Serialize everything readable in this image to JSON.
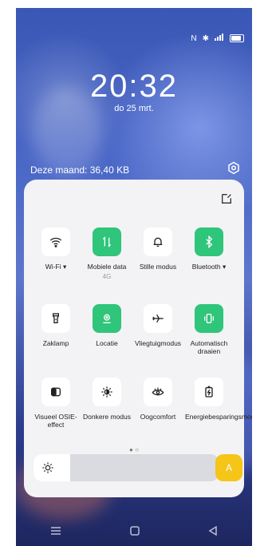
{
  "status": {
    "icons": [
      "nfc-icon",
      "bluetooth-icon",
      "signal-icon",
      "battery-icon"
    ]
  },
  "lock": {
    "time": "20:32",
    "date": "do 25 mrt."
  },
  "usage": {
    "text": "Deze maand: 36,40 KB"
  },
  "panel": {
    "tiles": [
      {
        "label": "Wi-Fi ▾",
        "sublabel": "",
        "icon": "wifi-icon",
        "active": false
      },
      {
        "label": "Mobiele data",
        "sublabel": "4G",
        "icon": "mobile-data-icon",
        "active": true
      },
      {
        "label": "Stille modus",
        "sublabel": "",
        "icon": "bell-icon",
        "active": false
      },
      {
        "label": "Bluetooth ▾",
        "sublabel": "",
        "icon": "bluetooth-icon",
        "active": true
      },
      {
        "label": "Zaklamp",
        "sublabel": "",
        "icon": "flashlight-icon",
        "active": false
      },
      {
        "label": "Locatie",
        "sublabel": "",
        "icon": "location-icon",
        "active": true
      },
      {
        "label": "Vliegtuigmodus",
        "sublabel": "",
        "icon": "airplane-icon",
        "active": false
      },
      {
        "label": "Automatisch draaien",
        "sublabel": "",
        "icon": "auto-rotate-icon",
        "active": true
      },
      {
        "label": "Visueel OSIE-effect",
        "sublabel": "",
        "icon": "osie-icon",
        "active": false
      },
      {
        "label": "Donkere modus",
        "sublabel": "",
        "icon": "dark-mode-icon",
        "active": false
      },
      {
        "label": "Oogcomfort",
        "sublabel": "",
        "icon": "eye-icon",
        "active": false
      },
      {
        "label": "Energiebesparingsmodus",
        "sublabel": "",
        "icon": "battery-saver-icon",
        "active": false
      }
    ],
    "pager": "● ○",
    "brightness": {
      "level": 0.2,
      "auto_label": "A"
    }
  },
  "colors": {
    "active": "#2fc57a",
    "auto": "#f5c518",
    "panel": "#f3f3f5"
  }
}
